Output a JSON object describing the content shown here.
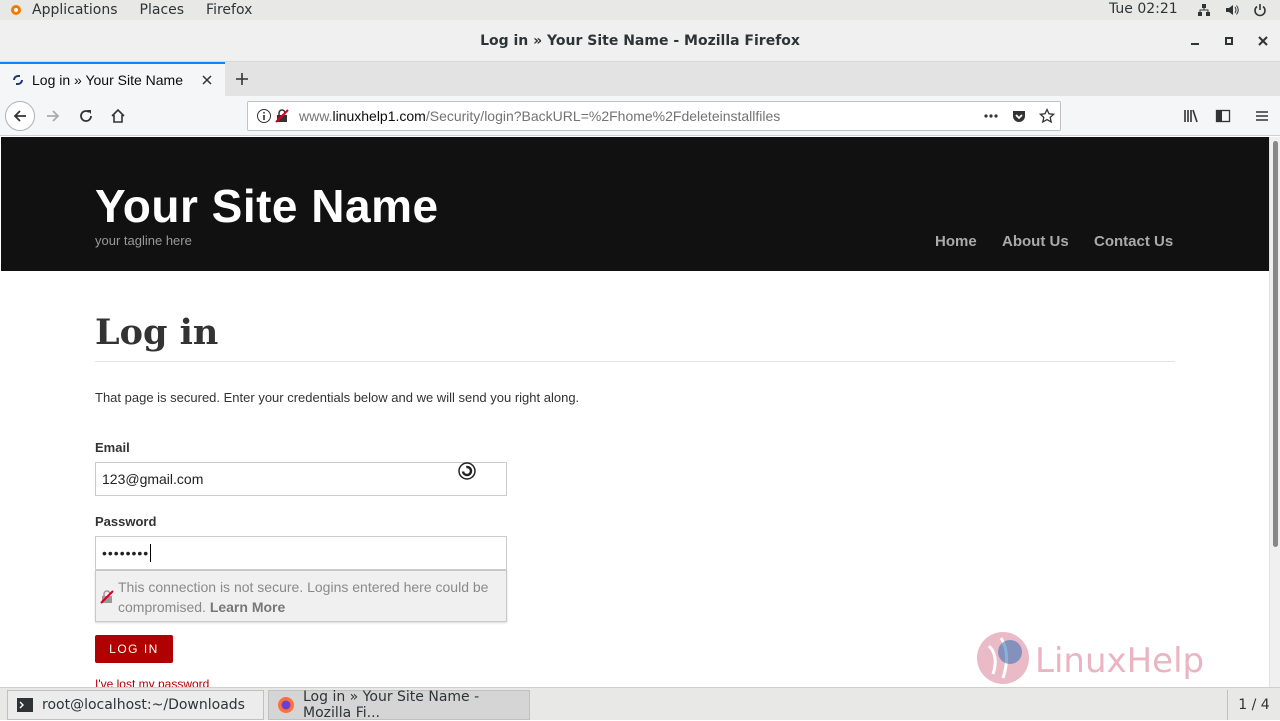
{
  "topbar": {
    "applications": "Applications",
    "places": "Places",
    "firefox": "Firefox",
    "clock": "Tue 02:21"
  },
  "window": {
    "title": "Log in » Your Site Name - Mozilla Firefox"
  },
  "tab": {
    "label": "Log in » Your Site Name"
  },
  "urlbar": {
    "domain_prefix": "www.",
    "domain": "linuxhelp1.com",
    "path": "/Security/login?BackURL=%2Fhome%2Fdeleteinstallfiles"
  },
  "site": {
    "name": "Your Site Name",
    "tagline": "your tagline here",
    "nav": [
      "Home",
      "About Us",
      "Contact Us"
    ]
  },
  "login": {
    "title": "Log in",
    "message": "That page is secured. Enter your credentials below and we will send you right along.",
    "email_label": "Email",
    "email_value": "123@gmail.com",
    "password_label": "Password",
    "password_value": "••••••••",
    "insecure_warning": "This connection is not secure. Logins entered here could be compromised.",
    "learn_more": "Learn More",
    "button": "LOG IN",
    "lost_password": "I've lost my password"
  },
  "watermark": "LinuxHelp",
  "taskbar": {
    "terminal": "root@localhost:~/Downloads",
    "firefox": "Log in » Your Site Name - Mozilla Fi...",
    "pager": "1 / 4"
  },
  "colors": {
    "header_bg": "#111111",
    "accent_red": "#b10000",
    "tab_highlight": "#0a84ff"
  }
}
